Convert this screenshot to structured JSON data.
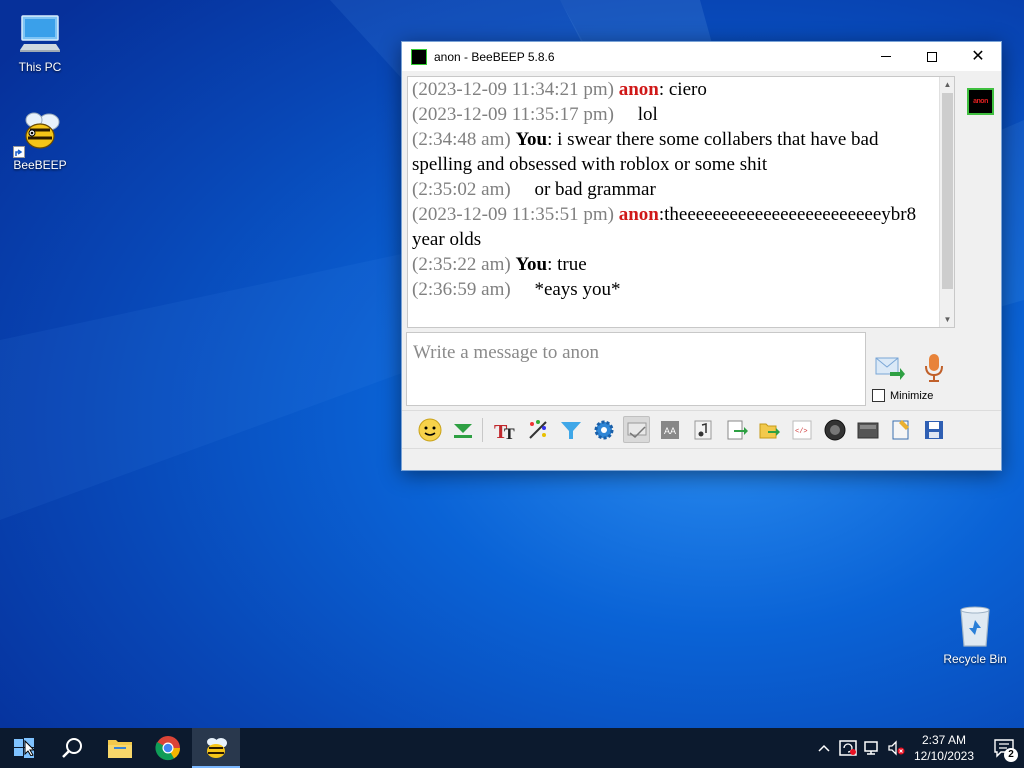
{
  "desktop": {
    "icons": [
      {
        "label": "This PC",
        "icon": "computer-icon"
      },
      {
        "label": "BeeBEEP",
        "icon": "bee-icon"
      },
      {
        "label": "Recycle Bin",
        "icon": "recycle-bin-icon"
      }
    ]
  },
  "window": {
    "title": "anon - BeeBEEP 5.8.6",
    "messages": [
      {
        "time": "(2023-12-09 11:34:21 pm)",
        "sender": "anon",
        "sep": ": ",
        "text": "ciero"
      },
      {
        "time": "(2023-12-09 11:35:17 pm)",
        "sender": "",
        "sep": "    ",
        "text": "lol"
      },
      {
        "time": "(2:34:48 am)",
        "sender": "You",
        "sep": ": ",
        "text": "i swear there some collabers that have bad spelling and obsessed with roblox or some shit"
      },
      {
        "time": "(2:35:02 am)",
        "sender": "",
        "sep": "    ",
        "text": "or bad grammar"
      },
      {
        "time": "(2023-12-09 11:35:51 pm)",
        "sender": "anon",
        "sep": ":",
        "text": "theeeeeeeeeeeeeeeeeeeeeeeeybr8 year olds"
      },
      {
        "time": "(2:35:22 am)",
        "sender": "You",
        "sep": ": ",
        "text": "true"
      },
      {
        "time": "(2:36:59 am)",
        "sender": "",
        "sep": "    ",
        "text": "*eays you*"
      }
    ],
    "input_placeholder": "Write a message to anon",
    "minimize_label": "Minimize",
    "toolbar_icons": [
      "emoticon-icon",
      "green-arrow-down-icon",
      "font-icon",
      "color-palette-icon",
      "filter-icon",
      "settings-gear-icon",
      "spellcheck-icon",
      "text-format-icon",
      "music-note-icon",
      "send-file-icon",
      "share-folder-icon",
      "html-code-icon",
      "webcam-icon",
      "screenshot-icon",
      "notes-icon",
      "save-icon"
    ]
  },
  "taskbar": {
    "apps": [
      "start-icon",
      "search-icon",
      "file-explorer-icon",
      "chrome-icon",
      "beebeep-icon"
    ],
    "clock_time": "2:37 AM",
    "clock_date": "12/10/2023",
    "notifications_count": "2"
  },
  "colors": {
    "anon_name": "#d01818",
    "timestamp": "#808080",
    "desktop_blue": "#0a63d6",
    "taskbar": "#0c1a2e"
  }
}
